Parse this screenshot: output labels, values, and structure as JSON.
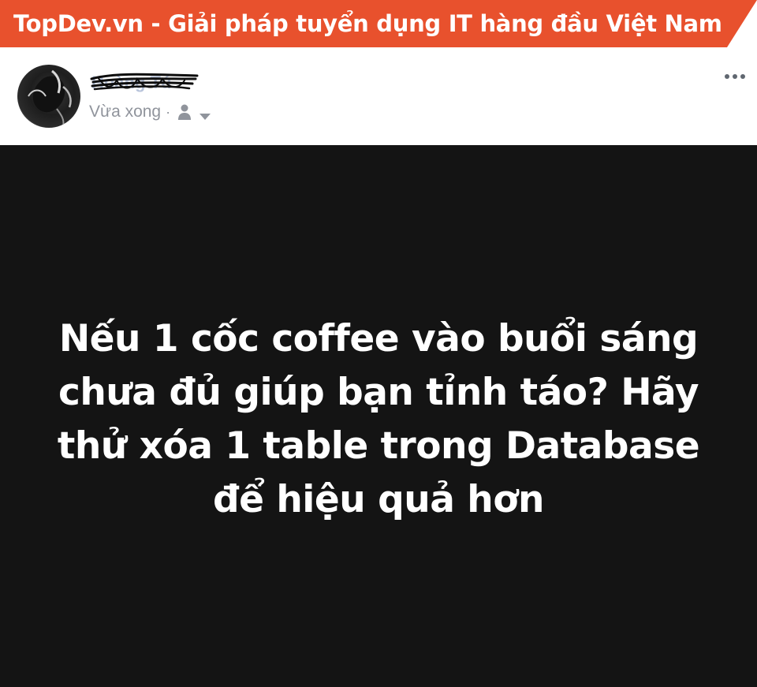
{
  "banner": {
    "text": "TopDev.vn - Giải pháp tuyển dụng IT hàng đầu Việt Nam",
    "color": "#e8512d"
  },
  "post": {
    "author": {
      "name": "Hoàng Tú",
      "name_is_scribbled_out": true
    },
    "timestamp": "Vừa xong",
    "separator": "·",
    "audience_icon": "person-icon",
    "audience_dropdown_icon": "chevron-down-icon",
    "more_options_icon": "ellipsis-icon",
    "content": {
      "text": "Nếu 1 cốc coffee vào buổi sáng chưa đủ giúp bạn tỉnh táo? Hãy thử xóa 1 table trong Database để hiệu quả hơn",
      "background": "#141414",
      "text_color": "#ffffff"
    }
  },
  "colors": {
    "meta_text": "#90949c",
    "name_link": "#365899"
  }
}
